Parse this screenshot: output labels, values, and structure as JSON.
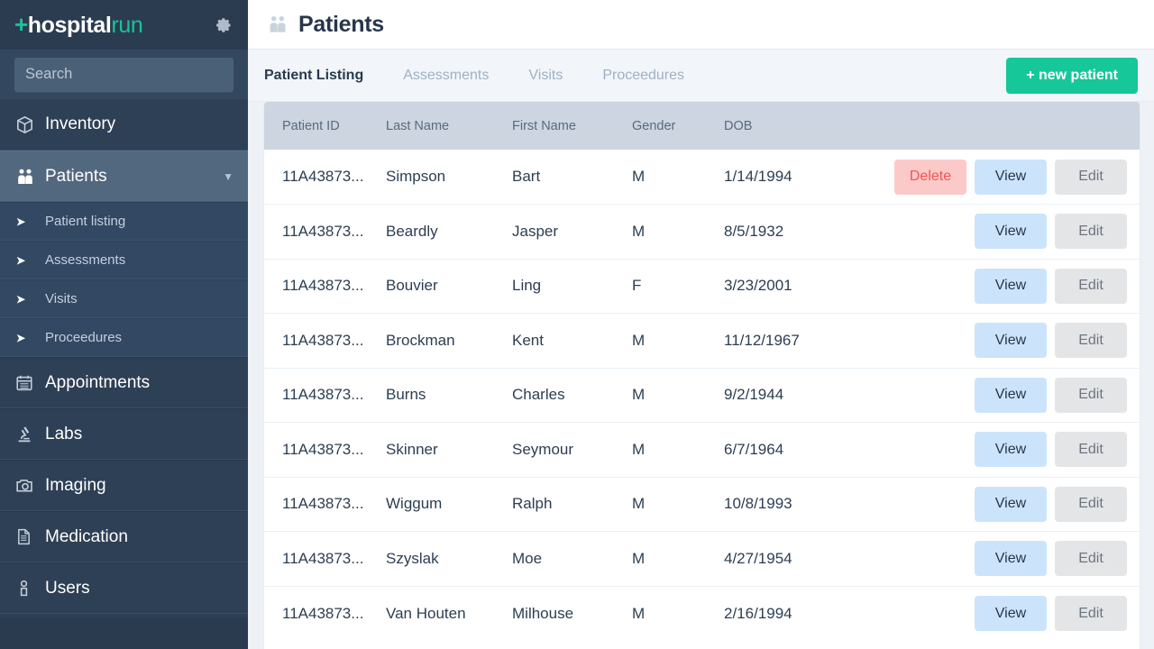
{
  "brand": {
    "plus": "+",
    "name_bold": "hospital",
    "name_light": "run"
  },
  "sidebar": {
    "search": {
      "placeholder": "Search",
      "value": ""
    },
    "items": [
      {
        "label": "Inventory",
        "icon": "box-icon",
        "active": false,
        "expandable": false
      },
      {
        "label": "Patients",
        "icon": "patients-icon",
        "active": true,
        "expandable": true
      },
      {
        "label": "Appointments",
        "icon": "calendar-icon",
        "active": false,
        "expandable": false
      },
      {
        "label": "Labs",
        "icon": "microscope-icon",
        "active": false,
        "expandable": false
      },
      {
        "label": "Imaging",
        "icon": "camera-icon",
        "active": false,
        "expandable": false
      },
      {
        "label": "Medication",
        "icon": "document-icon",
        "active": false,
        "expandable": false
      },
      {
        "label": "Users",
        "icon": "person-icon",
        "active": false,
        "expandable": false
      }
    ],
    "sub_items": [
      {
        "label": "Patient listing"
      },
      {
        "label": "Assessments"
      },
      {
        "label": "Visits"
      },
      {
        "label": "Proceedures"
      }
    ],
    "gear_icon": "gear-icon"
  },
  "header": {
    "title": "Patients",
    "icon": "patients-icon"
  },
  "tabs": [
    {
      "label": "Patient Listing",
      "active": true
    },
    {
      "label": "Assessments",
      "active": false
    },
    {
      "label": "Visits",
      "active": false
    },
    {
      "label": "Proceedures",
      "active": false
    }
  ],
  "new_patient_button": {
    "label": "+  new patient"
  },
  "table": {
    "columns": [
      "Patient ID",
      "Last Name",
      "First Name",
      "Gender",
      "DOB",
      ""
    ],
    "action_labels": {
      "delete": "Delete",
      "view": "View",
      "edit": "Edit"
    },
    "rows": [
      {
        "id": "11A43873...",
        "last": "Simpson",
        "first": "Bart",
        "gender": "M",
        "dob": "1/14/1994",
        "has_delete": true
      },
      {
        "id": "11A43873...",
        "last": "Beardly",
        "first": "Jasper",
        "gender": "M",
        "dob": "8/5/1932",
        "has_delete": false
      },
      {
        "id": "11A43873...",
        "last": "Bouvier",
        "first": "Ling",
        "gender": "F",
        "dob": "3/23/2001",
        "has_delete": false
      },
      {
        "id": "11A43873...",
        "last": "Brockman",
        "first": "Kent",
        "gender": "M",
        "dob": "11/12/1967",
        "has_delete": false
      },
      {
        "id": "11A43873...",
        "last": "Burns",
        "first": "Charles",
        "gender": "M",
        "dob": "9/2/1944",
        "has_delete": false
      },
      {
        "id": "11A43873...",
        "last": "Skinner",
        "first": "Seymour",
        "gender": "M",
        "dob": "6/7/1964",
        "has_delete": false
      },
      {
        "id": "11A43873...",
        "last": "Wiggum",
        "first": "Ralph",
        "gender": "M",
        "dob": "10/8/1993",
        "has_delete": false
      },
      {
        "id": "11A43873...",
        "last": "Szyslak",
        "first": "Moe",
        "gender": "M",
        "dob": "4/27/1954",
        "has_delete": false
      },
      {
        "id": "11A43873...",
        "last": "Van Houten",
        "first": "Milhouse",
        "gender": "M",
        "dob": "2/16/1994",
        "has_delete": false
      }
    ]
  },
  "colors": {
    "sidebar_bg": "#2e4055",
    "sidebar_active": "#52687f",
    "brand_green": "#18c39a",
    "accent_green": "#16c79a",
    "table_header_bg": "#ccd5e0",
    "delete_bg": "#fcc9c9",
    "delete_fg": "#f2544f",
    "view_bg": "#cce4fb",
    "edit_bg": "#e4e5e7"
  }
}
